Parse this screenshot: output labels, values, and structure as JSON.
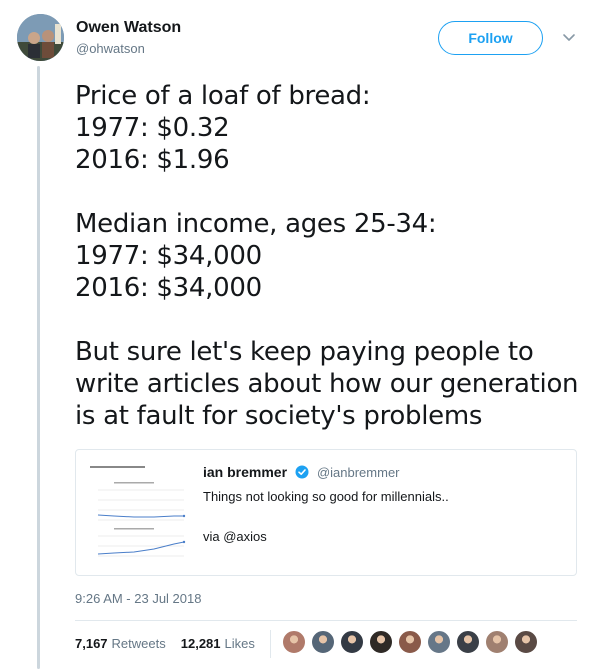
{
  "author": {
    "name": "Owen Watson",
    "handle": "@ohwatson"
  },
  "follow_button_label": "Follow",
  "tweet": {
    "lines": [
      "Price of a loaf of bread:",
      "1977: $0.32",
      "2016: $1.96",
      "",
      "Median income, ages 25-34:",
      "1977: $34,000",
      "2016: $34,000",
      "",
      "But sure let's keep paying people to",
      "write articles about how our generation",
      "is at fault for society's problems"
    ]
  },
  "quoted_tweet": {
    "name": "ian bremmer",
    "handle": "@ianbremmer",
    "text": "Things not looking so good for millennials..",
    "via": "via @axios",
    "verified": true
  },
  "timestamp": "9:26 AM - 23 Jul 2018",
  "stats": {
    "retweets_count": "7,167",
    "retweets_label": "Retweets",
    "likes_count": "12,281",
    "likes_label": "Likes"
  },
  "likers": [
    {
      "color": "#b07a6a"
    },
    {
      "color": "#556677"
    },
    {
      "color": "#333a44"
    },
    {
      "color": "#2f2a26"
    },
    {
      "color": "#8a5a4a"
    },
    {
      "color": "#667788"
    },
    {
      "color": "#3a3f47"
    },
    {
      "color": "#a08070"
    },
    {
      "color": "#5a4a44"
    }
  ],
  "colors": {
    "accent": "#1da1f2",
    "text_primary": "#14171a",
    "text_secondary": "#657786",
    "border": "#e1e8ed"
  }
}
